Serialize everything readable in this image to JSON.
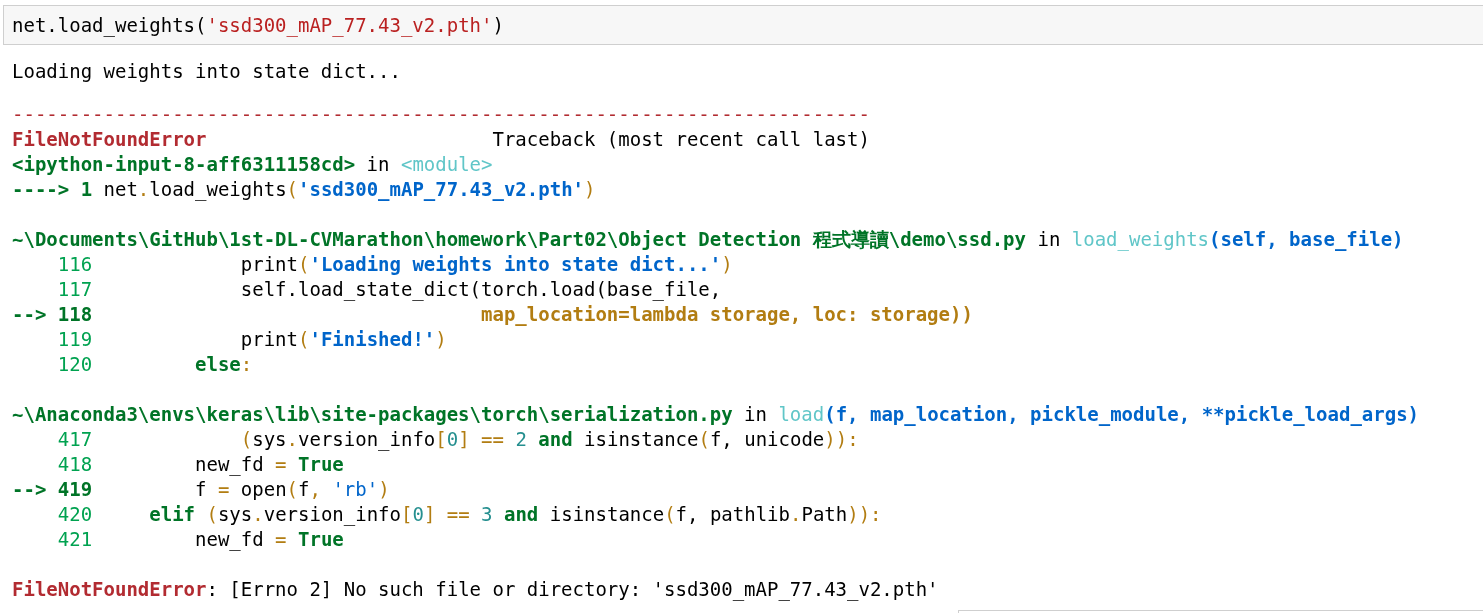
{
  "input_cell": {
    "tokens": [
      {
        "text": "net.load_weights(",
        "kind": "default"
      },
      {
        "text": "'ssd300_mAP_77.43_v2.pth'",
        "kind": "py_string"
      },
      {
        "text": ")",
        "kind": "default"
      }
    ]
  },
  "outputs": [
    {
      "kind": "stream",
      "lines": [
        {
          "kind": "code",
          "tokens": [
            {
              "text": "Loading weights into state dict...",
              "kind": "default"
            }
          ]
        }
      ]
    },
    {
      "kind": "error",
      "lines": [
        {
          "kind": "code",
          "tokens": [
            {
              "text": "---------------------------------------------------------------------------",
              "kind": "red"
            }
          ]
        },
        {
          "kind": "code",
          "tokens": [
            {
              "text": "FileNotFoundError",
              "kind": "bold_red"
            },
            {
              "text": "                         Traceback (most recent call last)",
              "kind": "default"
            }
          ]
        },
        {
          "kind": "code",
          "tokens": [
            {
              "text": "<ipython-input-8-aff6311158cd>",
              "kind": "bold_green"
            },
            {
              "text": " in ",
              "kind": "default"
            },
            {
              "text": "<module>",
              "kind": "cyan"
            }
          ]
        },
        {
          "kind": "code",
          "tokens": [
            {
              "text": "----> 1",
              "kind": "bold_green"
            },
            {
              "text": " net",
              "kind": "default"
            },
            {
              "text": ".",
              "kind": "yellow"
            },
            {
              "text": "load_weights",
              "kind": "default"
            },
            {
              "text": "(",
              "kind": "yellow"
            },
            {
              "text": "'ssd300_mAP_77.43_v2.pth'",
              "kind": "bold_blue"
            },
            {
              "text": ")",
              "kind": "yellow"
            }
          ]
        },
        {
          "kind": "blank"
        },
        {
          "kind": "code",
          "tokens": [
            {
              "text": "~\\Documents\\GitHub\\1st-DL-CVMarathon\\homework\\Part02\\Object Detection 程式導讀\\demo\\ssd.py",
              "kind": "bold_green"
            },
            {
              "text": " in ",
              "kind": "default"
            },
            {
              "text": "load_weights",
              "kind": "cyan"
            },
            {
              "text": "(self, base_file)",
              "kind": "bold_blue"
            }
          ]
        },
        {
          "kind": "code",
          "tokens": [
            {
              "text": "    116",
              "kind": "green"
            },
            {
              "text": "             print",
              "kind": "default"
            },
            {
              "text": "(",
              "kind": "yellow"
            },
            {
              "text": "'Loading weights into state dict...'",
              "kind": "bold_blue"
            },
            {
              "text": ")",
              "kind": "yellow"
            }
          ]
        },
        {
          "kind": "code",
          "tokens": [
            {
              "text": "    117",
              "kind": "green"
            },
            {
              "text": "             self.load_state_dict(torch.load(base_file,",
              "kind": "default"
            }
          ]
        },
        {
          "kind": "code",
          "tokens": [
            {
              "text": "--> 118",
              "kind": "bold_green"
            },
            {
              "text": "                                  map_location=lambda storage, loc: storage))",
              "kind": "bold_yellow"
            }
          ]
        },
        {
          "kind": "code",
          "tokens": [
            {
              "text": "    119",
              "kind": "green"
            },
            {
              "text": "             print",
              "kind": "default"
            },
            {
              "text": "(",
              "kind": "yellow"
            },
            {
              "text": "'Finished!'",
              "kind": "bold_blue"
            },
            {
              "text": ")",
              "kind": "yellow"
            }
          ]
        },
        {
          "kind": "code",
          "tokens": [
            {
              "text": "    120",
              "kind": "green"
            },
            {
              "text": "         else",
              "kind": "bold_green"
            },
            {
              "text": ":",
              "kind": "yellow"
            }
          ]
        },
        {
          "kind": "blank"
        },
        {
          "kind": "code",
          "tokens": [
            {
              "text": "~\\Anaconda3\\envs\\keras\\lib\\site-packages\\torch\\serialization.py",
              "kind": "bold_green"
            },
            {
              "text": " in ",
              "kind": "default"
            },
            {
              "text": "load",
              "kind": "cyan"
            },
            {
              "text": "(f, map_location, pickle_module, **pickle_load_args)",
              "kind": "bold_blue"
            }
          ]
        },
        {
          "kind": "code",
          "tokens": [
            {
              "text": "    417",
              "kind": "green"
            },
            {
              "text": "             (",
              "kind": "yellow"
            },
            {
              "text": "sys",
              "kind": "default"
            },
            {
              "text": ".",
              "kind": "yellow"
            },
            {
              "text": "version_info",
              "kind": "default"
            },
            {
              "text": "[",
              "kind": "yellow"
            },
            {
              "text": "0",
              "kind": "teal"
            },
            {
              "text": "] == ",
              "kind": "yellow"
            },
            {
              "text": "2 ",
              "kind": "teal"
            },
            {
              "text": "and",
              "kind": "bold_green"
            },
            {
              "text": " isinstance",
              "kind": "default"
            },
            {
              "text": "(",
              "kind": "yellow"
            },
            {
              "text": "f, unicode",
              "kind": "default"
            },
            {
              "text": "))",
              "kind": "yellow"
            },
            {
              "text": ":",
              "kind": "yellow"
            }
          ]
        },
        {
          "kind": "code",
          "tokens": [
            {
              "text": "    418",
              "kind": "green"
            },
            {
              "text": "         new_fd ",
              "kind": "default"
            },
            {
              "text": "= ",
              "kind": "yellow"
            },
            {
              "text": "True",
              "kind": "bold_green"
            }
          ]
        },
        {
          "kind": "code",
          "tokens": [
            {
              "text": "--> 419",
              "kind": "bold_green"
            },
            {
              "text": "         f ",
              "kind": "default"
            },
            {
              "text": "=",
              "kind": "yellow"
            },
            {
              "text": " open",
              "kind": "default"
            },
            {
              "text": "(",
              "kind": "yellow"
            },
            {
              "text": "f",
              "kind": "default"
            },
            {
              "text": ", ",
              "kind": "yellow"
            },
            {
              "text": "'rb'",
              "kind": "blue"
            },
            {
              "text": ")",
              "kind": "yellow"
            }
          ]
        },
        {
          "kind": "code",
          "tokens": [
            {
              "text": "    420",
              "kind": "green"
            },
            {
              "text": "     elif",
              "kind": "bold_green"
            },
            {
              "text": " (",
              "kind": "yellow"
            },
            {
              "text": "sys",
              "kind": "default"
            },
            {
              "text": ".",
              "kind": "yellow"
            },
            {
              "text": "version_info",
              "kind": "default"
            },
            {
              "text": "[",
              "kind": "yellow"
            },
            {
              "text": "0",
              "kind": "teal"
            },
            {
              "text": "] == ",
              "kind": "yellow"
            },
            {
              "text": "3 ",
              "kind": "teal"
            },
            {
              "text": "and",
              "kind": "bold_green"
            },
            {
              "text": " isinstance",
              "kind": "default"
            },
            {
              "text": "(",
              "kind": "yellow"
            },
            {
              "text": "f, pathlib",
              "kind": "default"
            },
            {
              "text": ".",
              "kind": "yellow"
            },
            {
              "text": "Path",
              "kind": "default"
            },
            {
              "text": "))",
              "kind": "yellow"
            },
            {
              "text": ":",
              "kind": "yellow"
            }
          ]
        },
        {
          "kind": "code",
          "tokens": [
            {
              "text": "    421",
              "kind": "green"
            },
            {
              "text": "         new_fd ",
              "kind": "default"
            },
            {
              "text": "= ",
              "kind": "yellow"
            },
            {
              "text": "True",
              "kind": "bold_green"
            }
          ]
        },
        {
          "kind": "blank"
        },
        {
          "kind": "code",
          "tokens": [
            {
              "text": "FileNotFoundError",
              "kind": "bold_red"
            },
            {
              "text": ": [Errno 2] No such file or directory: 'ssd300_mAP_77.43_v2.pth'",
              "kind": "default"
            }
          ]
        }
      ]
    }
  ]
}
